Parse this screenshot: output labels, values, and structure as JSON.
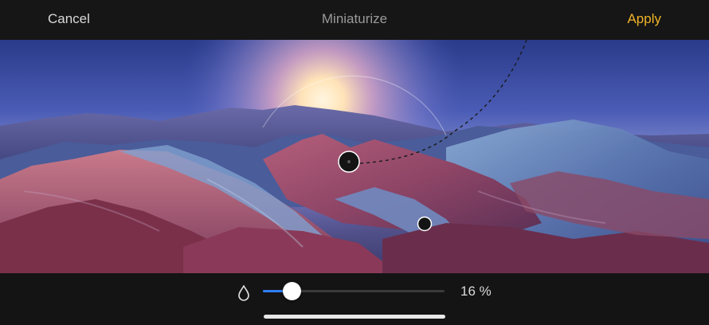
{
  "topbar": {
    "cancel_label": "Cancel",
    "title": "Miniaturize",
    "apply_label": "Apply"
  },
  "editor": {
    "effect": "tilt-shift blur",
    "control_handles": [
      "rotation-handle",
      "center-handle",
      "size-handle"
    ]
  },
  "bottombar": {
    "icon": "water-drop-icon",
    "slider_value": 0.16,
    "value_label": "16 %"
  },
  "colors": {
    "accent": "#f0b429",
    "slider_fill": "#2f7df6",
    "bar_background": "#141414"
  }
}
